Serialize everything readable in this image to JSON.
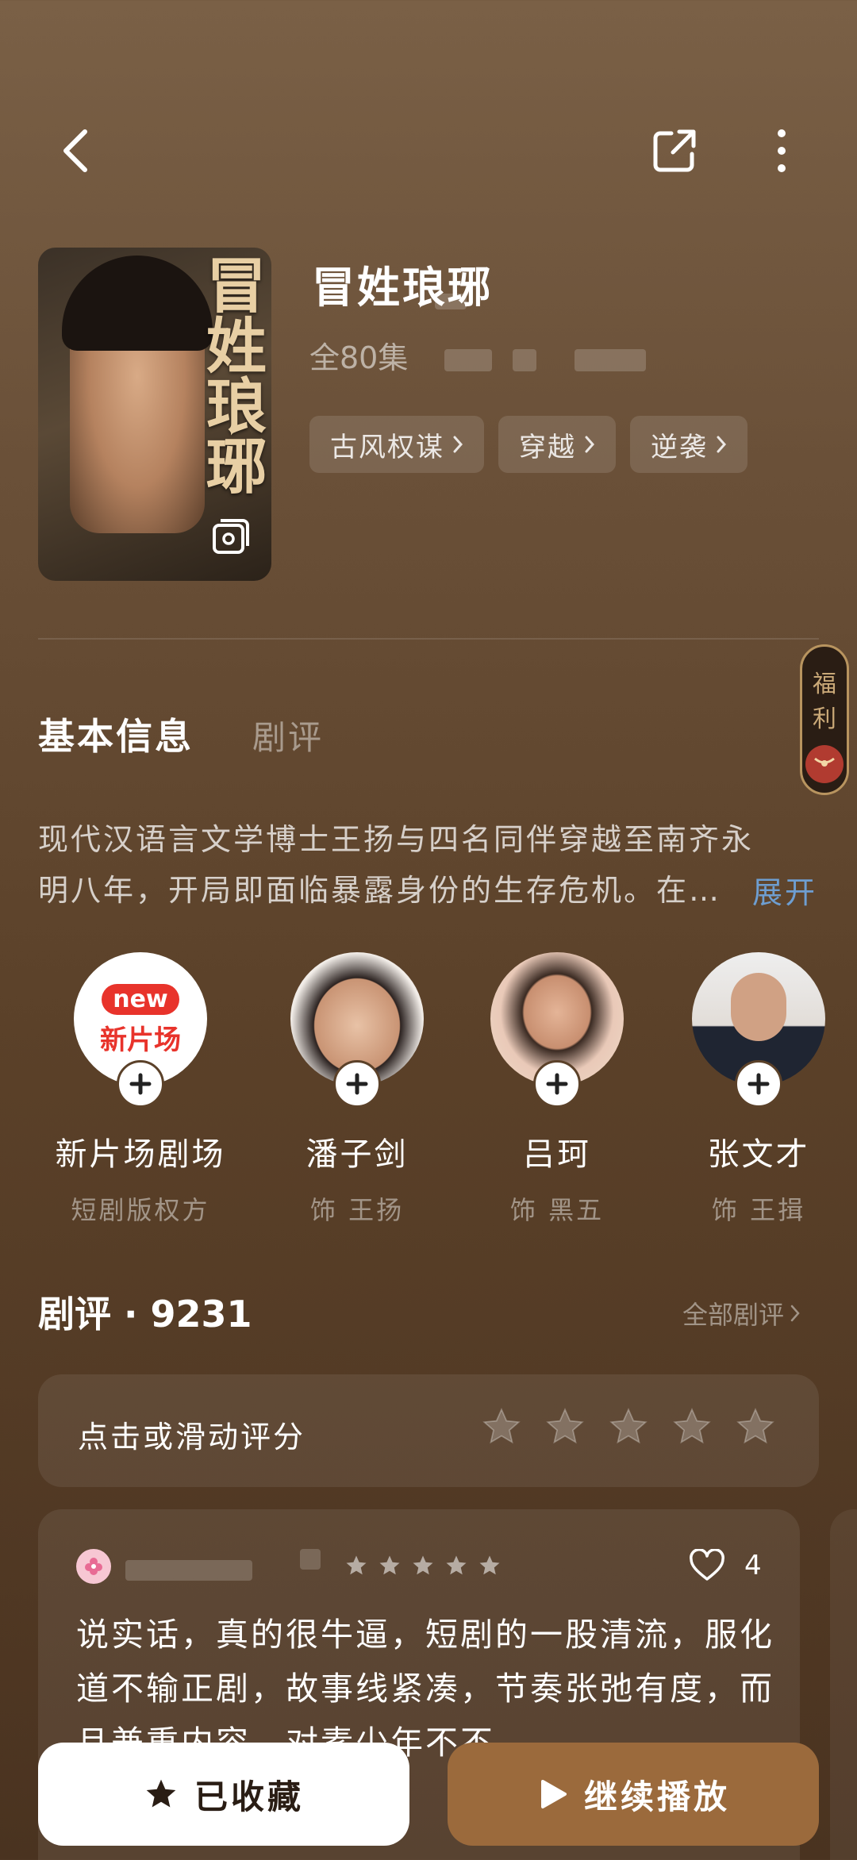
{
  "header": {
    "back_icon": "chevron-left-icon",
    "share_icon": "share-icon",
    "more_icon": "more-vertical-icon"
  },
  "drama": {
    "poster_title": "冒姓琅琊",
    "title": "冒姓琅琊",
    "episodes": "全80集",
    "tags": [
      "古风权谋",
      "穿越",
      "逆袭"
    ]
  },
  "welfare": {
    "label": "福利"
  },
  "tabs": {
    "basic_info": "基本信息",
    "reviews": "剧评"
  },
  "synopsis": {
    "text": "现代汉语言文学博士王扬与四名同伴穿越至南齐永明八年，开局即面临暴露身份的生存危机。在…",
    "expand_label": "展开"
  },
  "cast": [
    {
      "name": "新片场剧场",
      "role": "短剧版权方",
      "avatar_badge": "new",
      "avatar_text": "新片场"
    },
    {
      "name": "潘子剑",
      "role": "饰 王扬"
    },
    {
      "name": "吕珂",
      "role": "饰 黑五"
    },
    {
      "name": "张文才",
      "role": "饰 王揖"
    }
  ],
  "reviews": {
    "heading": "剧评 · 9231",
    "all_label": "全部剧评",
    "rate_prompt": "点击或滑动评分",
    "rating_stars": 5,
    "first": {
      "stars": 5,
      "likes": "4",
      "text": "说实话，真的很牛逼，短剧的一股清流，服化道不输正剧，故事线紧凑，节奏张弛有度，而且兼重内容，对素少年不不"
    }
  },
  "actions": {
    "favorite": "已收藏",
    "play": "继续播放"
  },
  "colors": {
    "accent": "#9b6a3c",
    "link": "#6e9ed1",
    "welfare_red": "#b13b30"
  }
}
